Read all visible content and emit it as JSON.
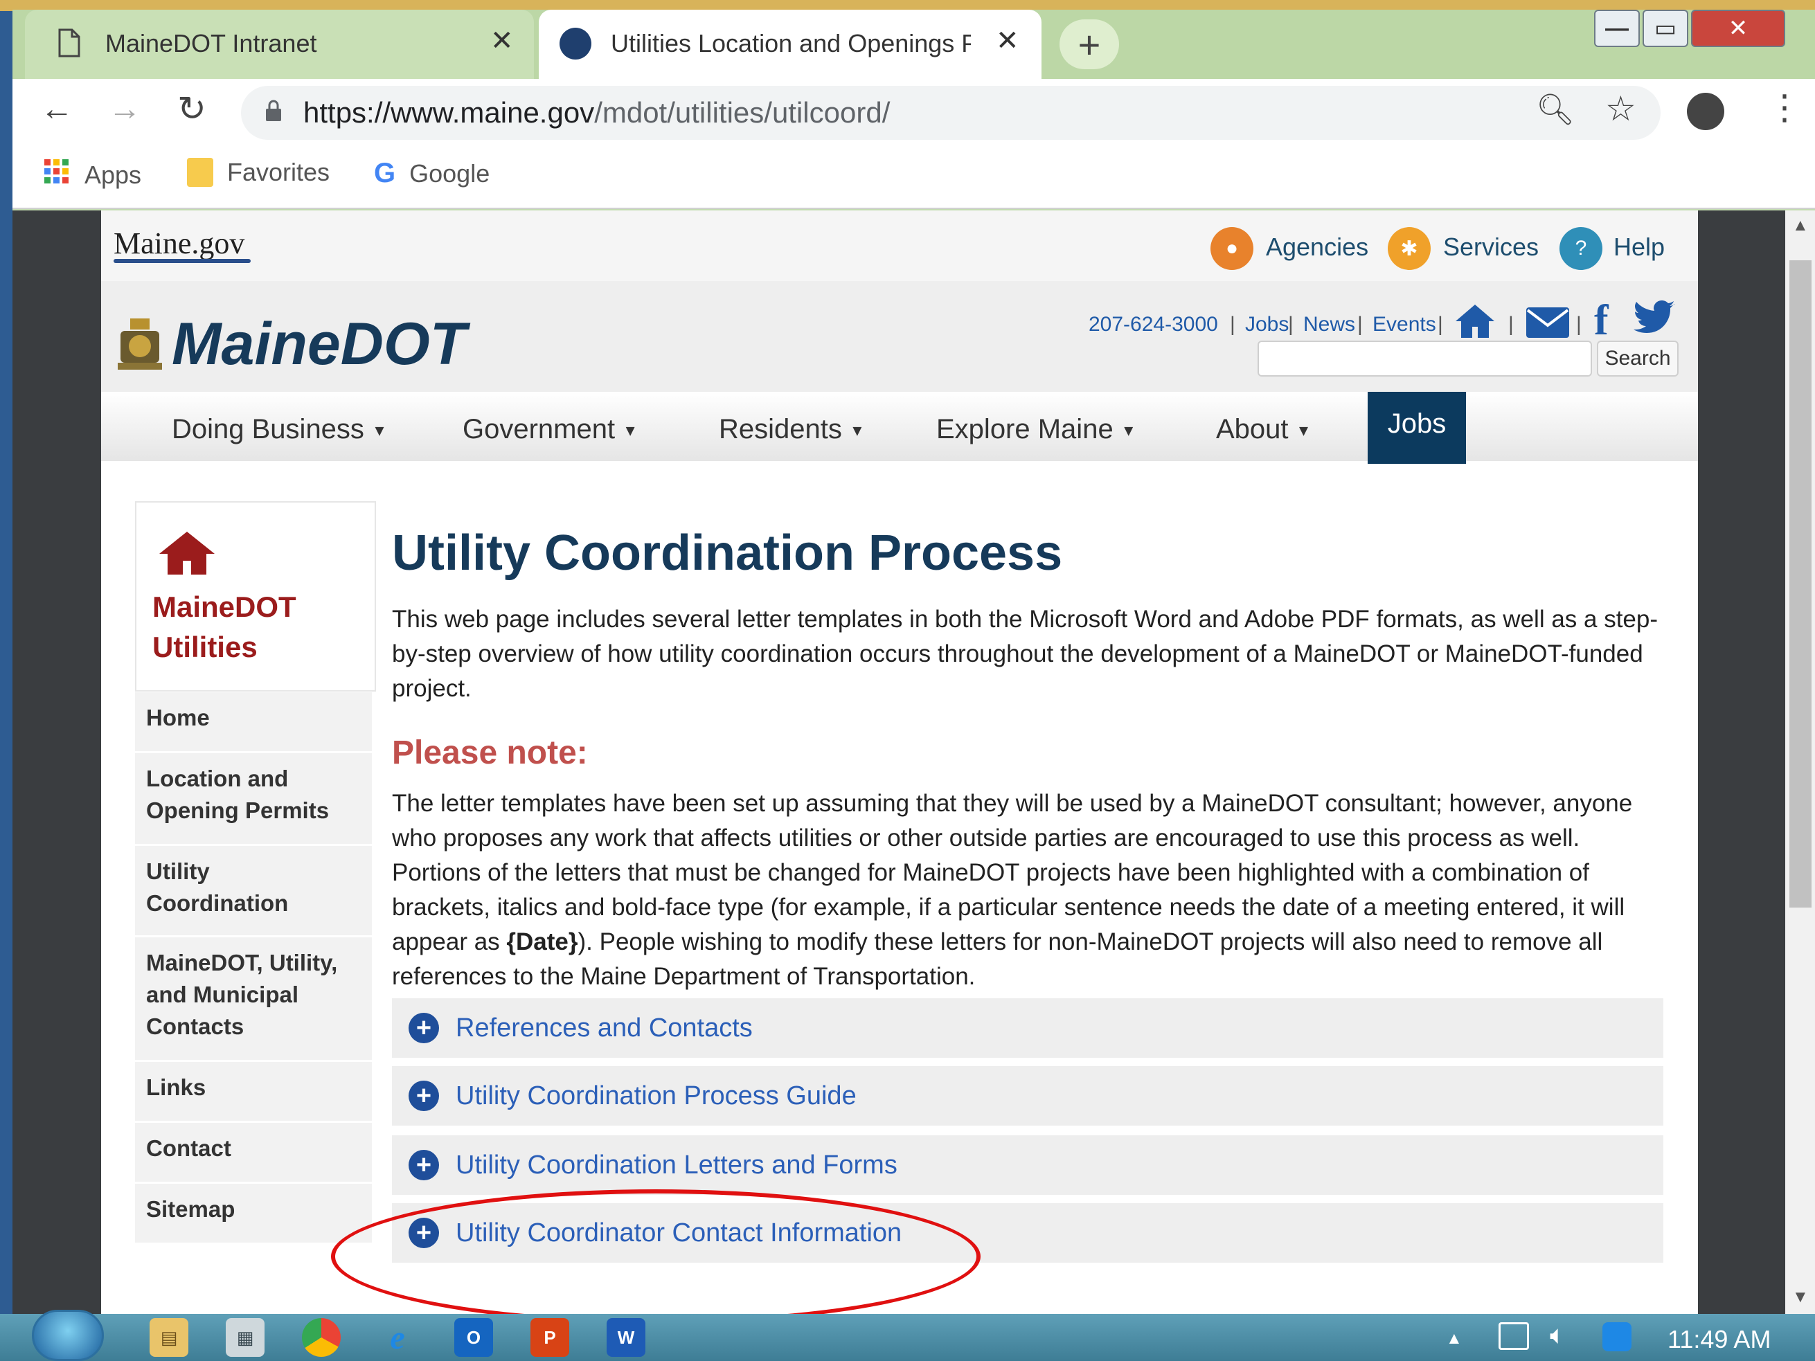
{
  "browser": {
    "tabs": [
      {
        "title": "MaineDOT Intranet",
        "icon": "page-icon"
      },
      {
        "title": "Utilities Location and Openings P",
        "icon": "maine-seal-icon"
      }
    ],
    "url_prefix": "https://www.maine.gov",
    "url_path": "/mdot/utilities/utilcoord/",
    "bookmarks": [
      "Apps",
      "Favorites",
      "Google"
    ]
  },
  "site": {
    "gov_logo": "Maine.gov",
    "top_links": [
      "Agencies",
      "Services",
      "Help"
    ],
    "brand": "MaineDOT",
    "phone": "207-624-3000",
    "contact_links": [
      "Jobs",
      "News",
      "Events"
    ],
    "separator": "|",
    "search_button": "Search",
    "nav": [
      "Doing Business",
      "Government",
      "Residents",
      "Explore Maine",
      "About"
    ],
    "nav_jobs": "Jobs"
  },
  "sidebar": {
    "title_line1": "MaineDOT",
    "title_line2": "Utilities",
    "items": [
      {
        "lines": [
          "Home"
        ]
      },
      {
        "lines": [
          "Location and",
          "Opening Permits"
        ]
      },
      {
        "lines": [
          "Utility",
          "Coordination"
        ]
      },
      {
        "lines": [
          "MaineDOT, Utility,",
          "and Municipal",
          "Contacts"
        ]
      },
      {
        "lines": [
          "Links"
        ]
      },
      {
        "lines": [
          "Contact"
        ]
      },
      {
        "lines": [
          "Sitemap"
        ]
      }
    ]
  },
  "main": {
    "title": "Utility Coordination Process",
    "intro": "This web page includes several letter templates in both the Microsoft Word and Adobe PDF formats, as well as a step-by-step overview of how utility coordination occurs throughout the development of a MaineDOT or MaineDOT-funded project.",
    "note_heading": "Please note:",
    "note_before": "The letter templates have been set up assuming that they will be used by a MaineDOT consultant; however, anyone who proposes any work that affects utilities or other outside parties are encouraged to use this process as well. Portions of the letters that must be changed for MaineDOT projects have been highlighted with a combination of brackets, italics and bold-face type (for example, if a particular sentence needs the date of a meeting entered, it will appear as ",
    "note_bold": "{Date}",
    "note_after": "). People wishing to modify these letters for non-MaineDOT projects will also need to remove all references to the Maine Department of Transportation.",
    "accordion": [
      "References and Contacts",
      "Utility Coordination Process Guide",
      "Utility Coordination Letters and Forms",
      "Utility Coordinator Contact Information"
    ]
  },
  "taskbar": {
    "time": "11:49 AM"
  },
  "colors": {
    "brand_navy": "#163a5a",
    "brand_red": "#9b1c1c",
    "note_red": "#c0504d",
    "link_blue": "#2b5fb8",
    "annotation_red": "#e01010"
  }
}
